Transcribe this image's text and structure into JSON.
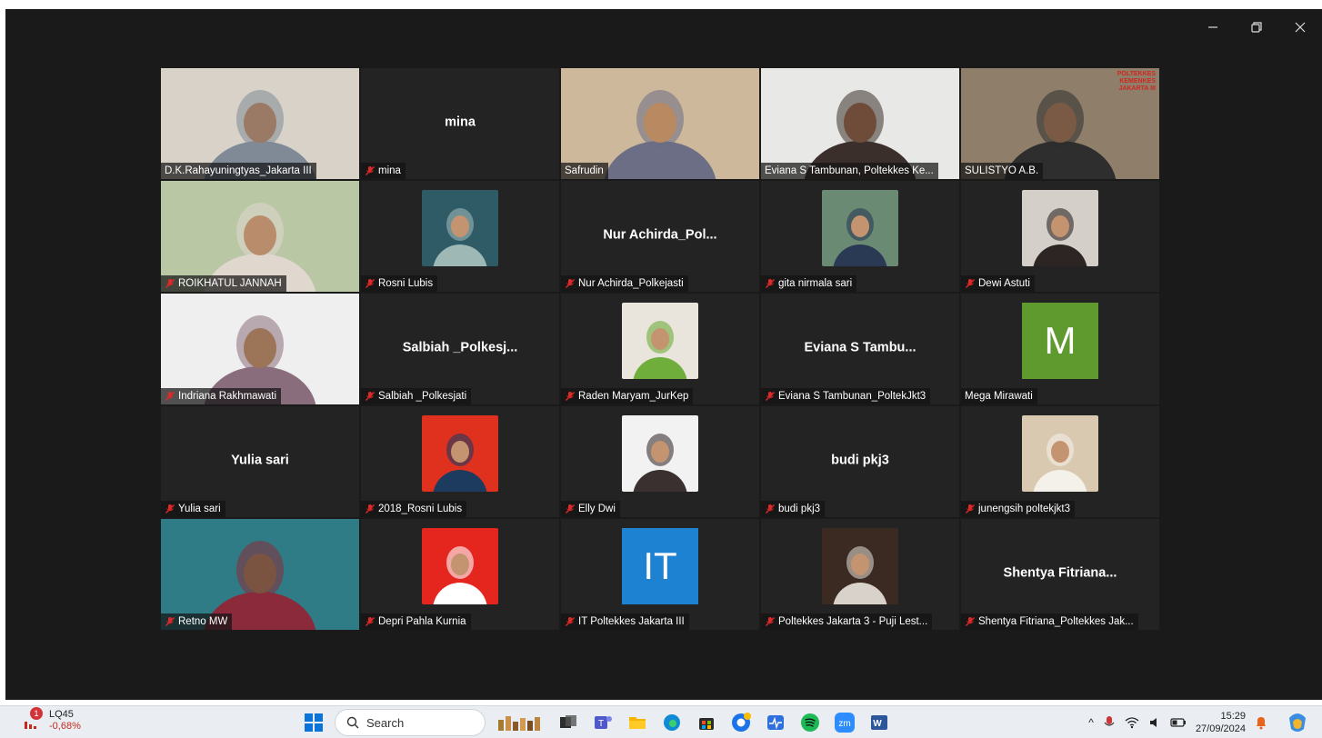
{
  "window": {
    "controls": [
      "minimize",
      "restore",
      "close"
    ]
  },
  "participants": [
    {
      "name": "D.K.Rahayuningtyas_Jakarta III",
      "type": "video",
      "muted": false,
      "bg": "#d9d2c8",
      "skin": "#9a7a64",
      "cloth": "#7f8a96"
    },
    {
      "name": "mina",
      "type": "name",
      "display": "mina",
      "muted": true
    },
    {
      "name": "Safrudin",
      "type": "video",
      "muted": false,
      "bg": "#cdb89b",
      "skin": "#b98a62",
      "cloth": "#6b6e85"
    },
    {
      "name": "Eviana S Tambunan, Poltekkes Ke...",
      "type": "video",
      "muted": false,
      "bg": "#e8e8e6",
      "skin": "#6f4c3a",
      "cloth": "#3a2f2b"
    },
    {
      "name": "SULISTYO A.B.",
      "type": "video",
      "muted": false,
      "active": true,
      "bg": "#8f7f6a",
      "skin": "#7a5a45",
      "cloth": "#2e2e2e",
      "overlay_text": [
        "POLTEKKES",
        "KEMENKES",
        "JAKARTA III"
      ]
    },
    {
      "name": "ROIKHATUL JANNAH",
      "type": "video",
      "muted": true,
      "bg": "#b9c7a4",
      "skin": "#b98c6c",
      "cloth": "#e0d7cf"
    },
    {
      "name": "Rosni Lubis",
      "type": "photo",
      "muted": true,
      "bg": "#2f5b66",
      "accent": "#9db8b5"
    },
    {
      "name": "Nur Achirda_Polkejasti",
      "type": "name",
      "display": "Nur  Achirda_Pol...",
      "muted": true
    },
    {
      "name": "gita nirmala sari",
      "type": "photo",
      "muted": true,
      "bg": "#6a8a74",
      "accent": "#2a3a54"
    },
    {
      "name": "Dewi Astuti",
      "type": "photo",
      "muted": true,
      "bg": "#d4cfc8",
      "accent": "#2d2523"
    },
    {
      "name": "Indriana Rakhmawati",
      "type": "video",
      "muted": true,
      "bg": "#efefef",
      "skin": "#9c7458",
      "cloth": "#8a6d7c"
    },
    {
      "name": "Salbiah _Polkesjati",
      "type": "name",
      "display": "Salbiah  _Polkesj...",
      "muted": true
    },
    {
      "name": "Raden Maryam_JurKep",
      "type": "photo",
      "muted": true,
      "bg": "#e9e4dc",
      "accent": "#6fae3a"
    },
    {
      "name": "Eviana S Tambunan_PoltekJkt3",
      "type": "name",
      "display": "Eviana  S  Tambu...",
      "muted": true
    },
    {
      "name": "Mega Mirawati",
      "type": "letter",
      "letter": "M",
      "muted": false,
      "bg": "#5f9a2e"
    },
    {
      "name": "Yulia sari",
      "type": "name",
      "display": "Yulia sari",
      "muted": true
    },
    {
      "name": "2018_Rosni Lubis",
      "type": "photo",
      "muted": true,
      "bg": "#e0301e",
      "accent": "#1d3a5f"
    },
    {
      "name": "Elly Dwi",
      "type": "photo",
      "muted": true,
      "bg": "#f2f2f2",
      "accent": "#3a3030"
    },
    {
      "name": "budi pkj3",
      "type": "name",
      "display": "budi pkj3",
      "muted": true
    },
    {
      "name": "junengsih poltekjkt3",
      "type": "photo",
      "muted": true,
      "bg": "#d9c9b0",
      "accent": "#f4f0ea"
    },
    {
      "name": "Retno MW",
      "type": "video",
      "muted": true,
      "bg": "#2f7c86",
      "skin": "#7a5440",
      "cloth": "#8a2a3a"
    },
    {
      "name": "Depri Pahla Kurnia",
      "type": "photo",
      "muted": true,
      "bg": "#e4261f",
      "accent": "#ffffff"
    },
    {
      "name": "IT Poltekkes Jakarta III",
      "type": "letter",
      "letter": "IT",
      "muted": true,
      "bg": "#1e82d2"
    },
    {
      "name": "Poltekkes Jakarta 3 - Puji Lest...",
      "type": "photo",
      "muted": true,
      "bg": "#3a2a22",
      "accent": "#d9d2ca"
    },
    {
      "name": "Shentya Fitriana_Poltekkes Jak...",
      "type": "name",
      "display": "Shentya  Fitriana...",
      "muted": true
    }
  ],
  "taskbar": {
    "stock_badge": "1",
    "stock_name": "LQ45",
    "stock_change": "-0,68%",
    "search_label": "Search",
    "time": "15:29",
    "date": "27/09/2024"
  }
}
